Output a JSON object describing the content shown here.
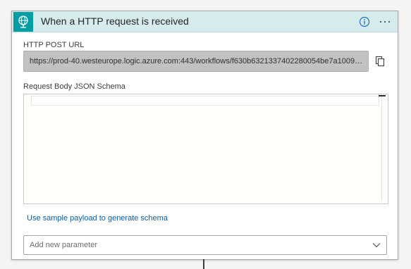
{
  "trigger": {
    "title": "When a HTTP request is received",
    "icon": "globe-request-icon",
    "accent_color": "#009da5",
    "header_bg": "#d6ecec"
  },
  "fields": {
    "url_label": "HTTP POST URL",
    "url_value": "https://prod-40.westeurope.logic.azure.com:443/workflows/f630b6321337402280054be7a10094b...",
    "schema_label": "Request Body JSON Schema",
    "schema_value": ""
  },
  "actions": {
    "sample_link": "Use sample payload to generate schema",
    "add_param_placeholder": "Add new parameter"
  },
  "colors": {
    "link": "#0f5a9c",
    "info_icon": "#1e6fbf"
  }
}
